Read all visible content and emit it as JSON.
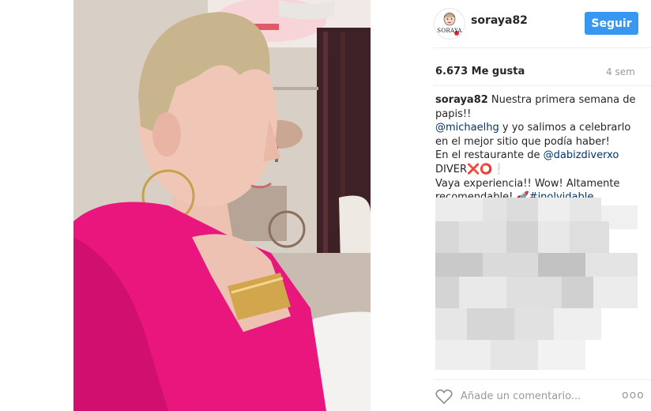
{
  "post": {
    "username": "soraya82",
    "follow_label": "Seguir",
    "avatar_text": "SORAYA",
    "likes": "6.673 Me gusta",
    "age": "4 sem",
    "caption": {
      "username": "soraya82",
      "line1": " Nuestra primera semana de papis!!",
      "mention1": "@michaelhg",
      "line2": " y yo salimos a celebrarlo en el mejor sitio que podía haber!",
      "line3": "En el restaurante de ",
      "mention2": "@dabizdiverxo",
      "line4": "DIVER❌⭕❕",
      "line5": "Vaya experiencia!! Wow! Altamente recomendable! ",
      "hashtag": "#inolvidable",
      "emoji_icon": "rocket-emoji"
    },
    "add_comment_placeholder": "Añade un comentario...",
    "more_label": "ooo"
  },
  "colors": {
    "follow": "#3897f0",
    "mention": "#003569",
    "muted": "#999999",
    "shirt": "#e8167d"
  },
  "icons": {
    "like": "heart-outline-icon",
    "more": "more-options-icon"
  }
}
